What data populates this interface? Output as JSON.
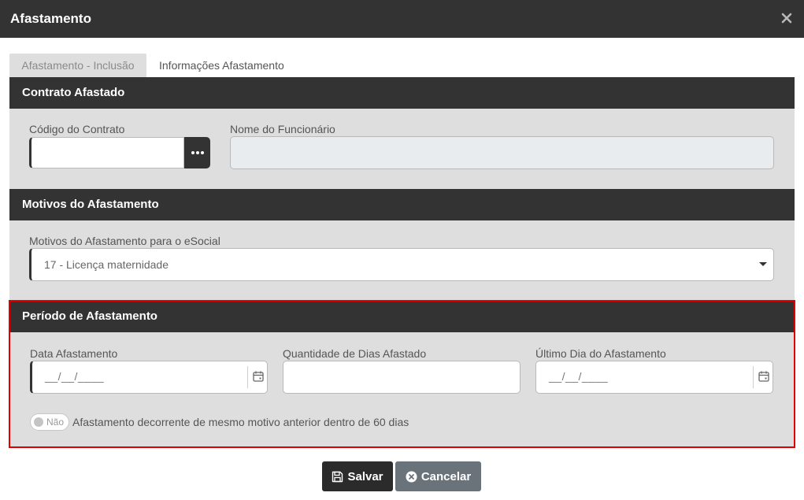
{
  "dialog": {
    "title": "Afastamento",
    "close_icon": "close-icon"
  },
  "tabs": [
    {
      "label": "Afastamento - Inclusão",
      "active": true
    },
    {
      "label": "Informações Afastamento",
      "active": false
    }
  ],
  "contrato": {
    "header": "Contrato Afastado",
    "codigo_label": "Código do Contrato",
    "codigo_value": "",
    "lookup_icon": "ellipsis-icon",
    "nome_label": "Nome do Funcionário",
    "nome_value": ""
  },
  "motivos": {
    "header": "Motivos do Afastamento",
    "select_label": "Motivos do Afastamento para o eSocial",
    "select_value": "17 - Licença maternidade"
  },
  "periodo": {
    "header": "Período de Afastamento",
    "data_label": "Data Afastamento",
    "data_value": "__/__/____",
    "qtd_label": "Quantidade de Dias Afastado",
    "qtd_value": "",
    "ultimo_label": "Último Dia do Afastamento",
    "ultimo_value": "__/__/____",
    "calendar_icon": "calendar-icon",
    "toggle_label": "Não",
    "toggle_text": "Afastamento decorrente de mesmo motivo anterior dentro de 60 dias"
  },
  "actions": {
    "save_label": "Salvar",
    "cancel_label": "Cancelar"
  },
  "colors": {
    "header": "#333333",
    "panel": "#dedede",
    "highlight": "#e00000",
    "cancel": "#6b737a"
  }
}
